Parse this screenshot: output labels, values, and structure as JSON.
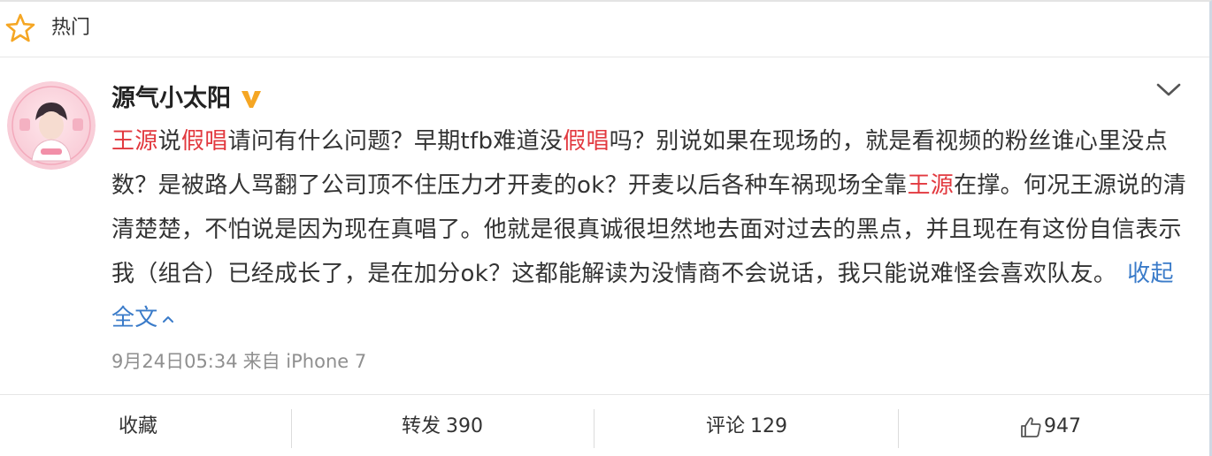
{
  "header": {
    "title": "热门",
    "icon": "star-icon"
  },
  "post": {
    "username": "源气小太阳",
    "vip_badge": "V",
    "content": [
      {
        "text": "王源",
        "highlight": true
      },
      {
        "text": "说",
        "highlight": false
      },
      {
        "text": "假唱",
        "highlight": true
      },
      {
        "text": "请问有什么问题？早期tfb难道没",
        "highlight": false
      },
      {
        "text": "假唱",
        "highlight": true
      },
      {
        "text": "吗？别说如果在现场的，就是看视频的粉丝谁心里没点数？是被路人骂翻了公司顶不住压力才开麦的ok？开麦以后各种车祸现场全靠",
        "highlight": false
      },
      {
        "text": "王源",
        "highlight": true
      },
      {
        "text": "在撑。何况王源说的清清楚楚，不怕说是因为现在真唱了。他就是很真诚很坦然地去面对过去的黑点，并且现在有这份自信表示我（组合）已经成长了，是在加分ok？这都能解读为没情商不会说话，我只能说难怪会喜欢队友。",
        "highlight": false
      }
    ],
    "collapse_label": "收起全文",
    "time": "9月24日05:34",
    "source": "来自 iPhone 7"
  },
  "actions": {
    "favorite_label": "收藏",
    "repost_label": "转发",
    "repost_count": "390",
    "comment_label": "评论",
    "comment_count": "129",
    "like_count": "947"
  },
  "colors": {
    "highlight": "#e2393f",
    "link": "#3a7bc9",
    "vip": "#f5a623",
    "star": "#f5a623"
  }
}
